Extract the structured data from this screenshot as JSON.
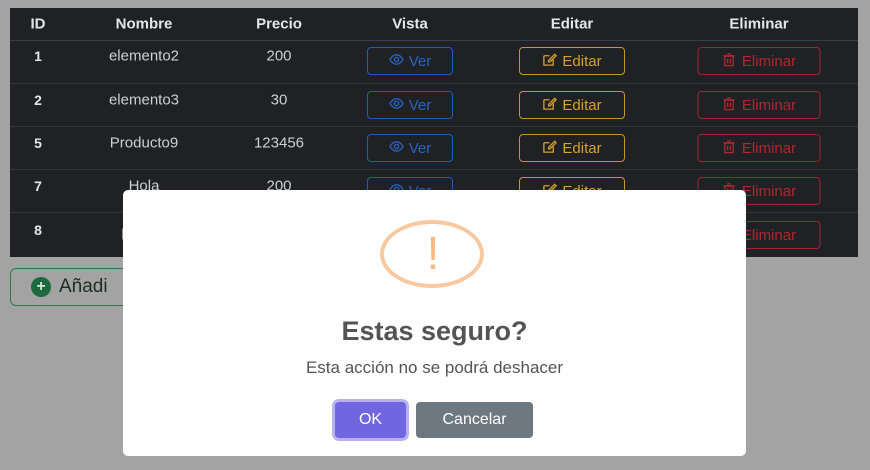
{
  "table": {
    "headers": {
      "id": "ID",
      "name": "Nombre",
      "price": "Precio",
      "view": "Vista",
      "edit": "Editar",
      "delete": "Eliminar"
    },
    "rows": [
      {
        "id": "1",
        "name": "elemento2",
        "price": "200",
        "view_label": "Ver",
        "edit_label": "Editar",
        "delete_label": "Eliminar"
      },
      {
        "id": "2",
        "name": "elemento3",
        "price": "30",
        "view_label": "Ver",
        "edit_label": "Editar",
        "delete_label": "Eliminar"
      },
      {
        "id": "5",
        "name": "Producto9",
        "price": "123456",
        "view_label": "Ver",
        "edit_label": "Editar",
        "delete_label": "Eliminar"
      },
      {
        "id": "7",
        "name": "Hola",
        "price": "200",
        "view_label": "Ver",
        "edit_label": "Editar",
        "delete_label": "Eliminar"
      },
      {
        "id": "8",
        "name": "pr",
        "price": "",
        "view_label": "",
        "edit_label": "",
        "delete_label": "Eliminar"
      }
    ]
  },
  "add_button": {
    "label": "Añadi"
  },
  "dialog": {
    "icon_symbol": "!",
    "title": "Estas seguro?",
    "text": "Esta acción no se podrá deshacer",
    "confirm_label": "OK",
    "cancel_label": "Cancelar"
  },
  "icons": {
    "view": "eye-icon",
    "edit": "pencil-square-icon",
    "delete": "trash-icon",
    "add": "plus-circle-icon",
    "warning": "exclamation-icon"
  },
  "colors": {
    "table_bg": "#1f2124",
    "view": "#2764c4",
    "edit": "#d6a32a",
    "delete": "#b3262f",
    "add": "#1e6a3e",
    "warning": "#f8bb86",
    "confirm": "#7066e0",
    "cancel": "#6e7881"
  }
}
